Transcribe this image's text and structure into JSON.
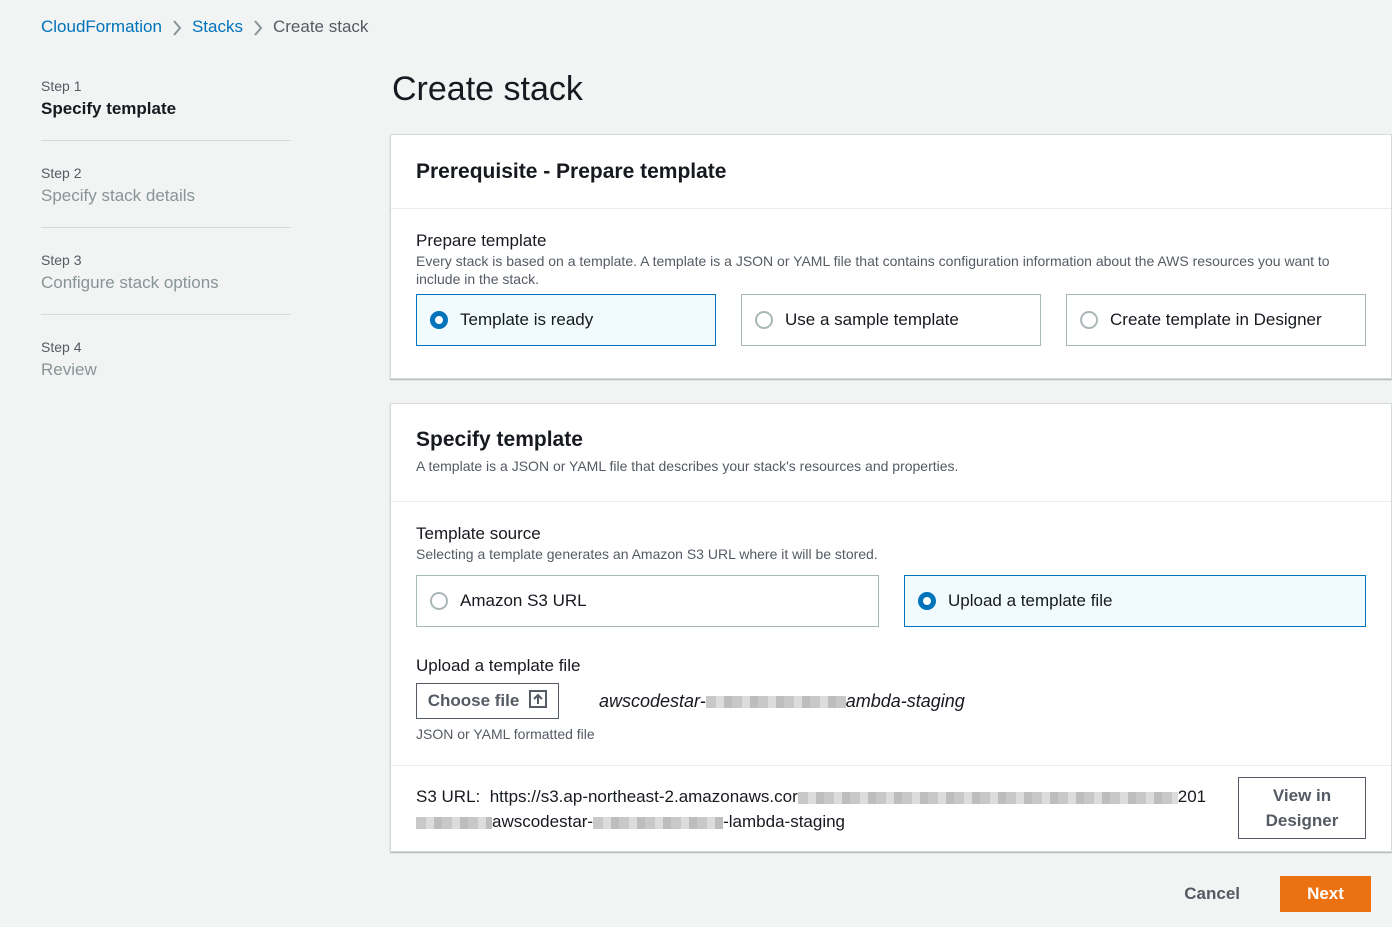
{
  "breadcrumb": {
    "items": [
      {
        "label": "CloudFormation"
      },
      {
        "label": "Stacks"
      },
      {
        "label": "Create stack"
      }
    ]
  },
  "steps": [
    {
      "number": "Step 1",
      "title": "Specify template",
      "active": true
    },
    {
      "number": "Step 2",
      "title": "Specify stack details",
      "active": false
    },
    {
      "number": "Step 3",
      "title": "Configure stack options",
      "active": false
    },
    {
      "number": "Step 4",
      "title": "Review",
      "active": false
    }
  ],
  "page_title": "Create stack",
  "prerequisite": {
    "title": "Prerequisite - Prepare template",
    "field_label": "Prepare template",
    "field_desc": "Every stack is based on a template. A template is a JSON or YAML file that contains configuration information about the AWS resources you want to include in the stack.",
    "options": [
      {
        "label": "Template is ready",
        "selected": true
      },
      {
        "label": "Use a sample template",
        "selected": false
      },
      {
        "label": "Create template in Designer",
        "selected": false
      }
    ]
  },
  "specify": {
    "title": "Specify template",
    "desc": "A template is a JSON or YAML file that describes your stack's resources and properties.",
    "source_label": "Template source",
    "source_desc": "Selecting a template generates an Amazon S3 URL where it will be stored.",
    "source_options": [
      {
        "label": "Amazon S3 URL",
        "selected": false
      },
      {
        "label": "Upload a template file",
        "selected": true
      }
    ],
    "upload_label": "Upload a template file",
    "choose_file_label": "Choose file",
    "file_name_prefix": "awscodestar-",
    "file_name_suffix": "ambda-staging",
    "upload_hint": "JSON or YAML formatted file",
    "s3_label": "S3 URL:",
    "s3_url_prefix": "https://s3.ap-northeast-2.amazonaws.cor",
    "s3_url_mid": "201",
    "s3_url_line2_a": "awscodestar-",
    "s3_url_line2_b": "-lambda-staging",
    "view_designer_label": "View in Designer"
  },
  "footer": {
    "cancel_label": "Cancel",
    "next_label": "Next"
  },
  "colors": {
    "link": "#0073bb",
    "primary": "#ec7211",
    "selected_tile_bg": "#f1faff"
  }
}
